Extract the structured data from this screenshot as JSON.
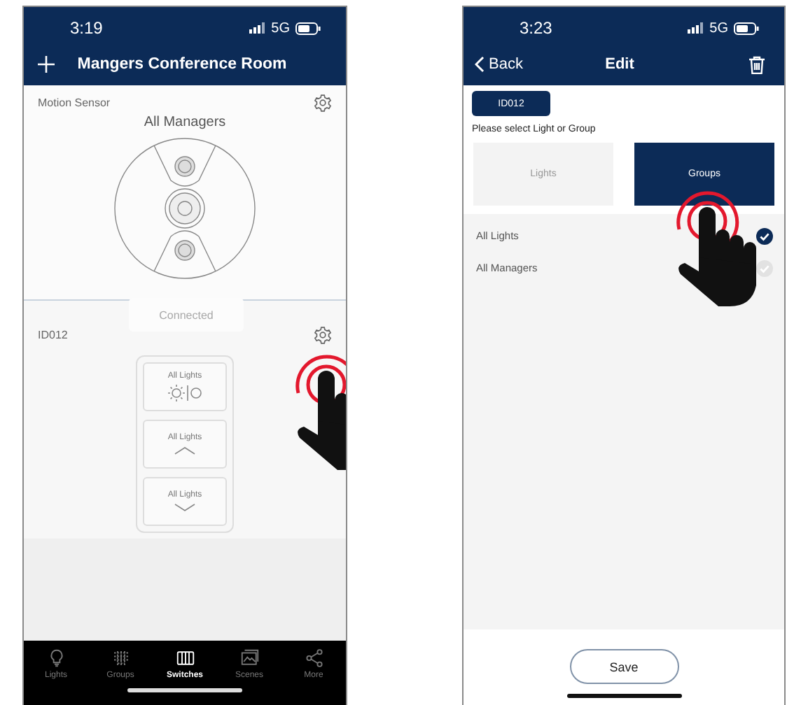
{
  "left_screen": {
    "status": {
      "time": "3:19",
      "network": "5G"
    },
    "title": "Mangers Conference Room",
    "sensor": {
      "label": "Motion Sensor",
      "group": "All Managers"
    },
    "toast": "Connected",
    "switch": {
      "label": "ID012",
      "buttons": [
        {
          "label": "All Lights",
          "kind": "toggle"
        },
        {
          "label": "All Lights",
          "kind": "up"
        },
        {
          "label": "All Lights",
          "kind": "down"
        }
      ]
    },
    "tabs": [
      {
        "label": "Lights",
        "selected": false
      },
      {
        "label": "Groups",
        "selected": false
      },
      {
        "label": "Switches",
        "selected": true
      },
      {
        "label": "Scenes",
        "selected": false
      },
      {
        "label": "More",
        "selected": false
      }
    ]
  },
  "right_screen": {
    "status": {
      "time": "3:23",
      "network": "5G"
    },
    "back": "Back",
    "title": "Edit",
    "badge": "ID012",
    "prompt": "Please select Light or Group",
    "options": [
      {
        "label": "Lights",
        "selected": false
      },
      {
        "label": "Groups",
        "selected": true
      }
    ],
    "items": [
      {
        "label": "All Lights",
        "checked": true
      },
      {
        "label": "All Managers",
        "checked": false
      }
    ],
    "save": "Save"
  }
}
